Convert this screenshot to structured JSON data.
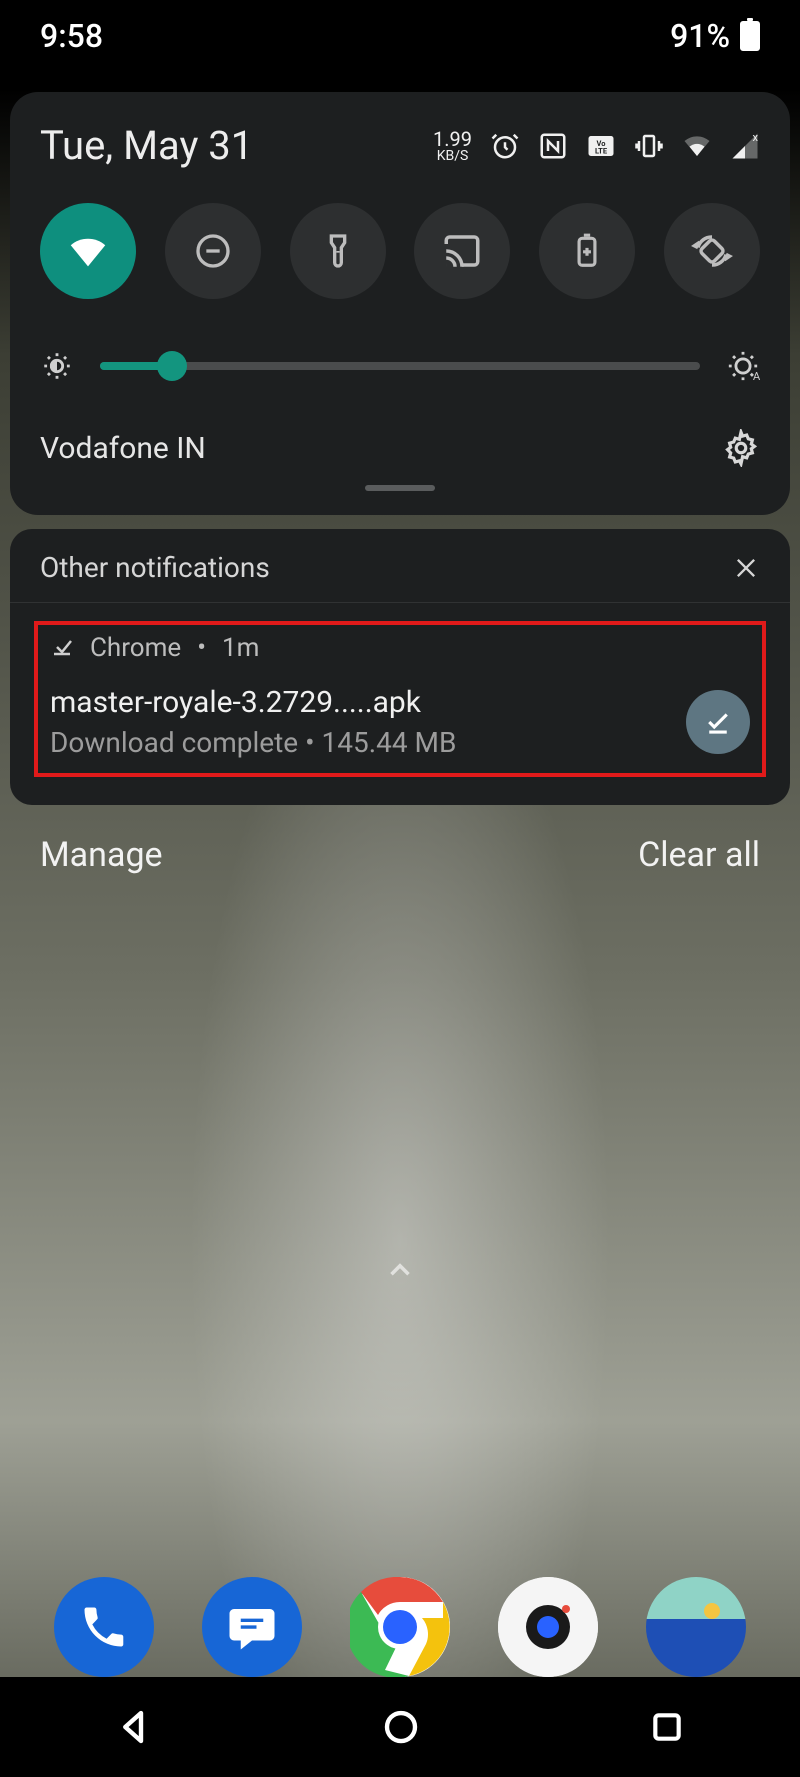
{
  "status_bar": {
    "time": "9:58",
    "battery_percent": "91%"
  },
  "quick_settings": {
    "date": "Tue, May 31",
    "network_speed_value": "1.99",
    "network_speed_unit": "KB/S",
    "carrier": "Vodafone IN",
    "toggles": {
      "wifi": "wifi",
      "dnd": "do-not-disturb",
      "flashlight": "flashlight",
      "cast": "cast",
      "battery_saver": "battery-saver",
      "rotate": "auto-rotate"
    }
  },
  "notifications": {
    "section_title": "Other notifications",
    "item": {
      "app": "Chrome",
      "age": "1m",
      "separator": "•",
      "title": "master-royale-3.2729.....apk",
      "subtitle": "Download complete • 145.44 MB"
    }
  },
  "actions": {
    "manage": "Manage",
    "clear_all": "Clear all"
  },
  "dock": {
    "phone": "Phone",
    "messages": "Messages",
    "chrome": "Chrome",
    "camera": "Camera",
    "gallery": "Gallery"
  }
}
